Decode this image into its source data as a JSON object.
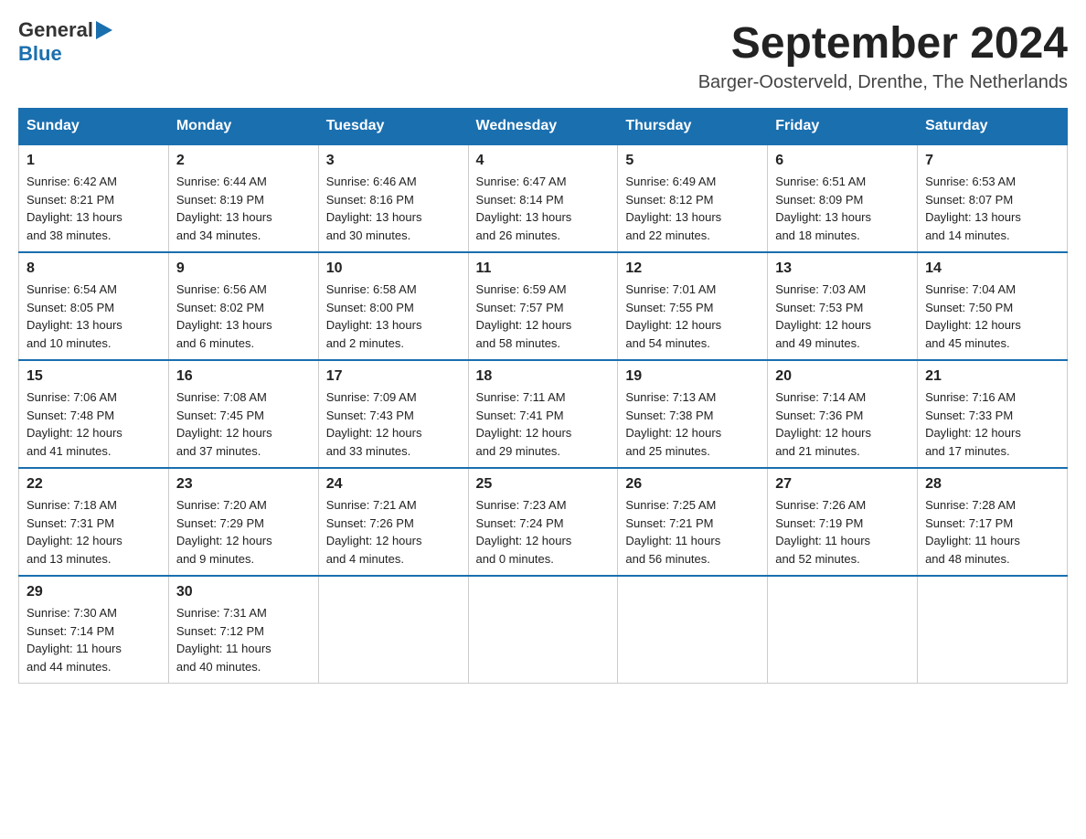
{
  "logo": {
    "general": "General",
    "blue": "Blue"
  },
  "title": "September 2024",
  "location": "Barger-Oosterveld, Drenthe, The Netherlands",
  "days_of_week": [
    "Sunday",
    "Monday",
    "Tuesday",
    "Wednesday",
    "Thursday",
    "Friday",
    "Saturday"
  ],
  "weeks": [
    [
      {
        "day": "1",
        "sunrise": "6:42 AM",
        "sunset": "8:21 PM",
        "daylight": "13 hours and 38 minutes."
      },
      {
        "day": "2",
        "sunrise": "6:44 AM",
        "sunset": "8:19 PM",
        "daylight": "13 hours and 34 minutes."
      },
      {
        "day": "3",
        "sunrise": "6:46 AM",
        "sunset": "8:16 PM",
        "daylight": "13 hours and 30 minutes."
      },
      {
        "day": "4",
        "sunrise": "6:47 AM",
        "sunset": "8:14 PM",
        "daylight": "13 hours and 26 minutes."
      },
      {
        "day": "5",
        "sunrise": "6:49 AM",
        "sunset": "8:12 PM",
        "daylight": "13 hours and 22 minutes."
      },
      {
        "day": "6",
        "sunrise": "6:51 AM",
        "sunset": "8:09 PM",
        "daylight": "13 hours and 18 minutes."
      },
      {
        "day": "7",
        "sunrise": "6:53 AM",
        "sunset": "8:07 PM",
        "daylight": "13 hours and 14 minutes."
      }
    ],
    [
      {
        "day": "8",
        "sunrise": "6:54 AM",
        "sunset": "8:05 PM",
        "daylight": "13 hours and 10 minutes."
      },
      {
        "day": "9",
        "sunrise": "6:56 AM",
        "sunset": "8:02 PM",
        "daylight": "13 hours and 6 minutes."
      },
      {
        "day": "10",
        "sunrise": "6:58 AM",
        "sunset": "8:00 PM",
        "daylight": "13 hours and 2 minutes."
      },
      {
        "day": "11",
        "sunrise": "6:59 AM",
        "sunset": "7:57 PM",
        "daylight": "12 hours and 58 minutes."
      },
      {
        "day": "12",
        "sunrise": "7:01 AM",
        "sunset": "7:55 PM",
        "daylight": "12 hours and 54 minutes."
      },
      {
        "day": "13",
        "sunrise": "7:03 AM",
        "sunset": "7:53 PM",
        "daylight": "12 hours and 49 minutes."
      },
      {
        "day": "14",
        "sunrise": "7:04 AM",
        "sunset": "7:50 PM",
        "daylight": "12 hours and 45 minutes."
      }
    ],
    [
      {
        "day": "15",
        "sunrise": "7:06 AM",
        "sunset": "7:48 PM",
        "daylight": "12 hours and 41 minutes."
      },
      {
        "day": "16",
        "sunrise": "7:08 AM",
        "sunset": "7:45 PM",
        "daylight": "12 hours and 37 minutes."
      },
      {
        "day": "17",
        "sunrise": "7:09 AM",
        "sunset": "7:43 PM",
        "daylight": "12 hours and 33 minutes."
      },
      {
        "day": "18",
        "sunrise": "7:11 AM",
        "sunset": "7:41 PM",
        "daylight": "12 hours and 29 minutes."
      },
      {
        "day": "19",
        "sunrise": "7:13 AM",
        "sunset": "7:38 PM",
        "daylight": "12 hours and 25 minutes."
      },
      {
        "day": "20",
        "sunrise": "7:14 AM",
        "sunset": "7:36 PM",
        "daylight": "12 hours and 21 minutes."
      },
      {
        "day": "21",
        "sunrise": "7:16 AM",
        "sunset": "7:33 PM",
        "daylight": "12 hours and 17 minutes."
      }
    ],
    [
      {
        "day": "22",
        "sunrise": "7:18 AM",
        "sunset": "7:31 PM",
        "daylight": "12 hours and 13 minutes."
      },
      {
        "day": "23",
        "sunrise": "7:20 AM",
        "sunset": "7:29 PM",
        "daylight": "12 hours and 9 minutes."
      },
      {
        "day": "24",
        "sunrise": "7:21 AM",
        "sunset": "7:26 PM",
        "daylight": "12 hours and 4 minutes."
      },
      {
        "day": "25",
        "sunrise": "7:23 AM",
        "sunset": "7:24 PM",
        "daylight": "12 hours and 0 minutes."
      },
      {
        "day": "26",
        "sunrise": "7:25 AM",
        "sunset": "7:21 PM",
        "daylight": "11 hours and 56 minutes."
      },
      {
        "day": "27",
        "sunrise": "7:26 AM",
        "sunset": "7:19 PM",
        "daylight": "11 hours and 52 minutes."
      },
      {
        "day": "28",
        "sunrise": "7:28 AM",
        "sunset": "7:17 PM",
        "daylight": "11 hours and 48 minutes."
      }
    ],
    [
      {
        "day": "29",
        "sunrise": "7:30 AM",
        "sunset": "7:14 PM",
        "daylight": "11 hours and 44 minutes."
      },
      {
        "day": "30",
        "sunrise": "7:31 AM",
        "sunset": "7:12 PM",
        "daylight": "11 hours and 40 minutes."
      },
      null,
      null,
      null,
      null,
      null
    ]
  ],
  "labels": {
    "sunrise": "Sunrise:",
    "sunset": "Sunset:",
    "daylight": "Daylight:"
  }
}
